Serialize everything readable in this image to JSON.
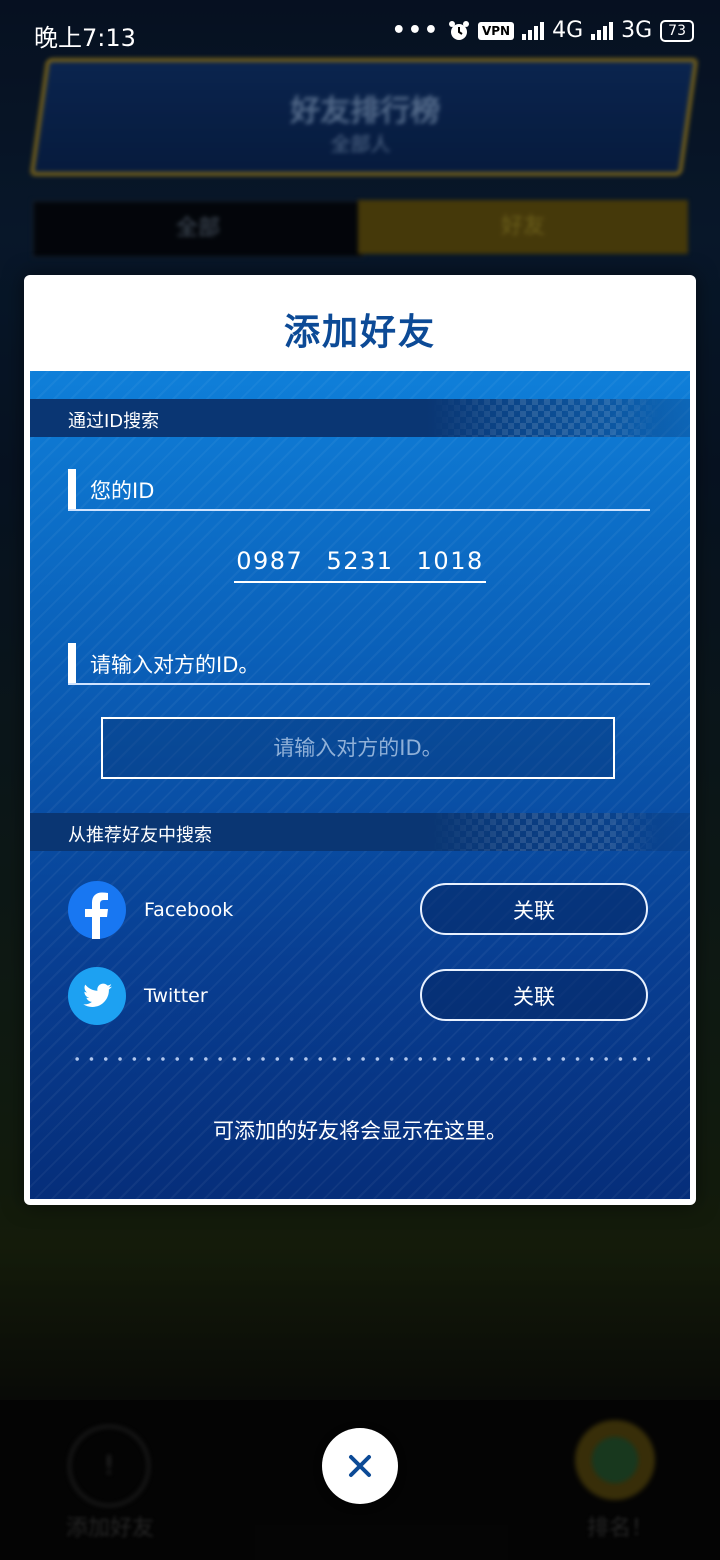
{
  "status_bar": {
    "time": "晚上7:13",
    "vpn": "VPN",
    "net1": "4G",
    "net2": "3G",
    "battery": "73"
  },
  "background": {
    "banner_title": "好友排行榜",
    "banner_sub": "全部人",
    "tab_left": "全部",
    "tab_right": "好友",
    "bottom_left_label": "添加好友",
    "bottom_right_label": "排名！"
  },
  "dialog": {
    "title": "添加好友",
    "section_search_by_id": "通过ID搜索",
    "your_id_label": "您的ID",
    "your_id_value": "0987  5231  1018",
    "enter_id_label": "请输入对方的ID。",
    "id_input_placeholder": "请输入对方的ID。",
    "section_recommended": "从推荐好友中搜索",
    "social": [
      {
        "name": "Facebook",
        "icon": "facebook-icon",
        "button": "关联",
        "color": "#1877f2"
      },
      {
        "name": "Twitter",
        "icon": "twitter-icon",
        "button": "关联",
        "color": "#1da1f2"
      }
    ],
    "empty_message": "可添加的好友将会显示在这里。"
  },
  "colors": {
    "title_blue": "#0c4a96",
    "panel_top": "#0f7fd9",
    "panel_bottom": "#062e7a"
  }
}
